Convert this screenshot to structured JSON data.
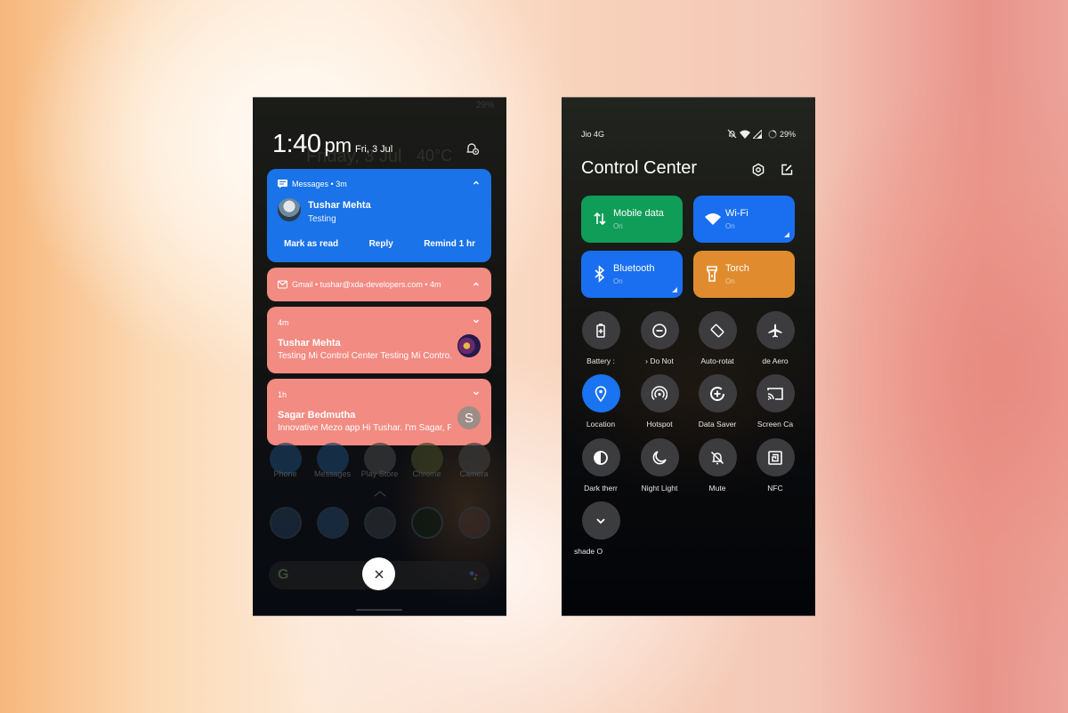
{
  "left_phone": {
    "status_battery": "29%",
    "clock": {
      "time": "1:40",
      "ampm": "pm",
      "date": "Fri, 3 Jul"
    },
    "ghost_date": "Friday, 3 Jul",
    "ghost_temperature": "40°C",
    "notifications": {
      "messages": {
        "app": "Messages",
        "age": "3m",
        "sender": "Tushar Mehta",
        "text": "Testing",
        "actions": [
          "Mark as read",
          "Reply",
          "Remind 1 hr"
        ],
        "color": "#1a73e8"
      },
      "gmail_header": {
        "app": "Gmail",
        "account": "tushar@xda-developers.com",
        "age": "4m",
        "color": "#f28b82"
      },
      "gmail_items": [
        {
          "age": "4m",
          "sender": "Tushar Mehta",
          "text": "Testing Mi Control Center Testing Mi Contro..",
          "avatar": "image"
        },
        {
          "age": "1h",
          "sender": "Sagar Bedmutha",
          "text": "Innovative Mezo app Hi Tushar. I'm Sagar, F..",
          "avatar_letter": "S"
        }
      ]
    },
    "dock_labels": [
      "Phone",
      "Messages",
      "Play Store",
      "Chrome",
      "Camera"
    ],
    "apps_row": [
      "trello-icon",
      "twitter-icon",
      "slack-icon",
      "spotify-icon",
      "google-one-icon"
    ],
    "search_logo": "G",
    "close_label": "×"
  },
  "right_phone": {
    "carrier": "Jio 4G",
    "battery": "29%",
    "title": "Control Center",
    "big_tiles": [
      {
        "name": "Mobile data",
        "state": "On",
        "icon": "mobile-data-icon",
        "color": "#0f9d58",
        "corner": false
      },
      {
        "name": "Wi-Fi",
        "state": "On",
        "icon": "wifi-icon",
        "color": "#1a6ff0",
        "corner": true
      },
      {
        "name": "Bluetooth",
        "state": "On",
        "icon": "bluetooth-icon",
        "color": "#1a6ff0",
        "corner": true
      },
      {
        "name": "Torch",
        "state": "On",
        "icon": "torch-icon",
        "color": "#e08c2e",
        "corner": false
      }
    ],
    "round_tiles": [
      {
        "label": "Battery :",
        "icon": "battery-saver-icon",
        "active": false
      },
      {
        "label": "›    Do Not",
        "icon": "do-not-disturb-icon",
        "active": false
      },
      {
        "label": "Auto-rotat",
        "icon": "auto-rotate-icon",
        "active": false
      },
      {
        "label": "de    Aero",
        "icon": "airplane-icon",
        "active": false
      },
      {
        "label": "Location",
        "icon": "location-icon",
        "active": true
      },
      {
        "label": "Hotspot",
        "icon": "hotspot-icon",
        "active": false
      },
      {
        "label": "Data Saver",
        "icon": "data-saver-icon",
        "active": false
      },
      {
        "label": "Screen Ca",
        "icon": "screen-cast-icon",
        "active": false
      },
      {
        "label": "Dark therr",
        "icon": "dark-theme-icon",
        "active": false
      },
      {
        "label": "Night Light",
        "icon": "night-light-icon",
        "active": false
      },
      {
        "label": "Mute",
        "icon": "mute-icon",
        "active": false
      },
      {
        "label": "NFC",
        "icon": "nfc-icon",
        "active": false
      },
      {
        "label": "shade    O",
        "icon": "expand-icon",
        "active": false
      }
    ]
  }
}
